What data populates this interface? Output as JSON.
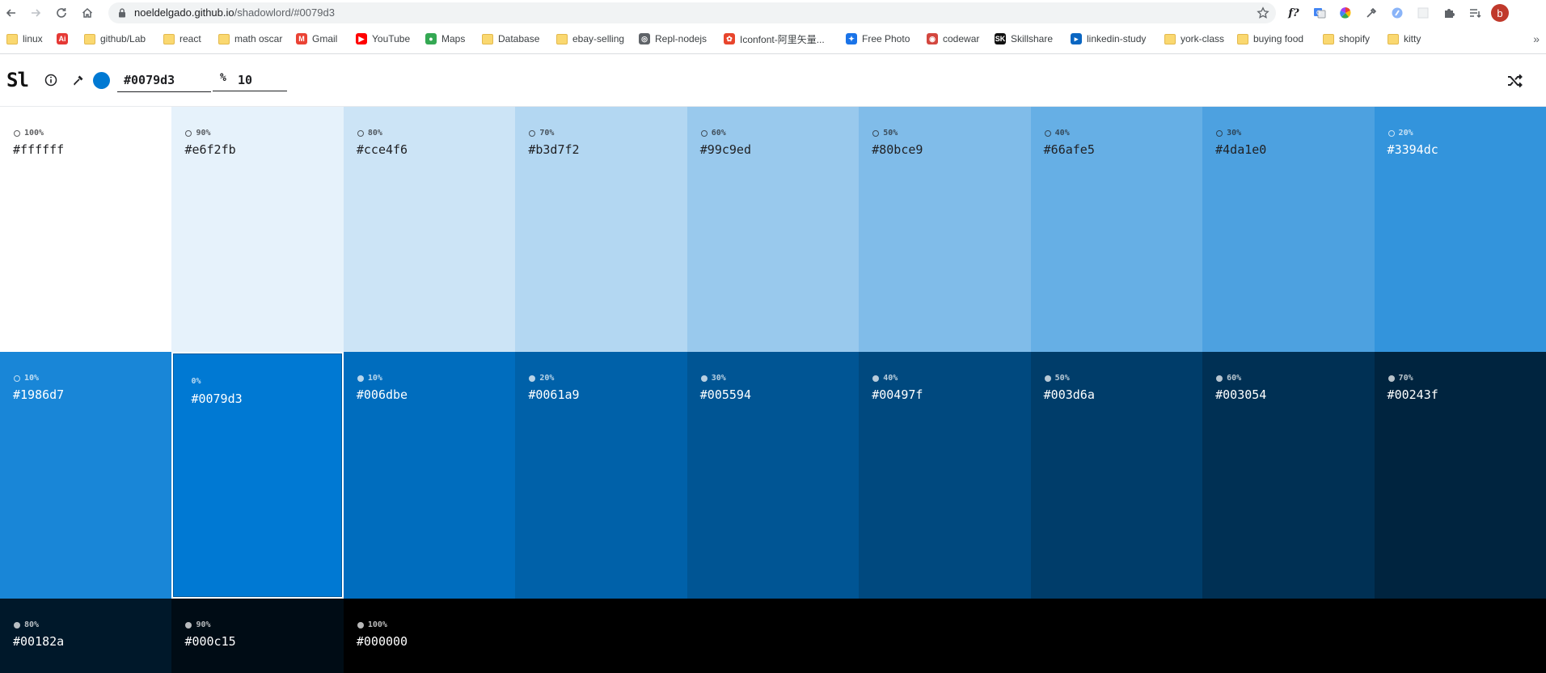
{
  "browser": {
    "url_host": "noeldelgado.github.io",
    "url_path": "/shadowlord/#0079d3",
    "extensions": [
      "f?",
      "google-translate-icon",
      "color-wheel-icon",
      "eyedropper-icon",
      "vpn-icon",
      "blank-ext-icon",
      "puzzle-icon",
      "reading-list-icon"
    ],
    "profile_initial": "b",
    "bookmarks": [
      {
        "label": "linux",
        "icon": "folder"
      },
      {
        "label": "",
        "icon": "adobe"
      },
      {
        "label": "github/Lab",
        "icon": "folder"
      },
      {
        "label": "react",
        "icon": "folder"
      },
      {
        "label": "math oscar",
        "icon": "folder"
      },
      {
        "label": "Gmail",
        "icon": "gmail"
      },
      {
        "label": "YouTube",
        "icon": "youtube"
      },
      {
        "label": "Maps",
        "icon": "maps"
      },
      {
        "label": "Database",
        "icon": "folder"
      },
      {
        "label": "ebay-selling",
        "icon": "folder"
      },
      {
        "label": "Repl-nodejs",
        "icon": "replit"
      },
      {
        "label": "Iconfont-阿里矢量...",
        "icon": "iconfont"
      },
      {
        "label": "Free Photo",
        "icon": "photo"
      },
      {
        "label": "codewar",
        "icon": "codewars"
      },
      {
        "label": "Skillshare",
        "icon": "skillshare"
      },
      {
        "label": "linkedin-study",
        "icon": "linkedin"
      },
      {
        "label": "york-class",
        "icon": "folder"
      },
      {
        "label": "buying food",
        "icon": "folder"
      },
      {
        "label": "shopify",
        "icon": "folder"
      },
      {
        "label": "kitty",
        "icon": "folder"
      }
    ],
    "more_label": "»"
  },
  "app": {
    "logo": "Sl",
    "base_color": "#0079d3",
    "color_value": "#0079d3",
    "step_icon": "%",
    "step_value": "10"
  },
  "tints": [
    {
      "pct": "100%",
      "hex": "#ffffff"
    },
    {
      "pct": "90%",
      "hex": "#e6f2fb"
    },
    {
      "pct": "80%",
      "hex": "#cce4f6"
    },
    {
      "pct": "70%",
      "hex": "#b3d7f2"
    },
    {
      "pct": "60%",
      "hex": "#99c9ed"
    },
    {
      "pct": "50%",
      "hex": "#80bce9"
    },
    {
      "pct": "40%",
      "hex": "#66afe5"
    },
    {
      "pct": "30%",
      "hex": "#4da1e0"
    },
    {
      "pct": "20%",
      "hex": "#3394dc"
    },
    {
      "pct": "10%",
      "hex": "#1986d7"
    }
  ],
  "base": {
    "pct": "0%",
    "hex": "#0079d3"
  },
  "shades": [
    {
      "pct": "10%",
      "hex": "#006dbe"
    },
    {
      "pct": "20%",
      "hex": "#0061a9"
    },
    {
      "pct": "30%",
      "hex": "#005594"
    },
    {
      "pct": "40%",
      "hex": "#00497f"
    },
    {
      "pct": "50%",
      "hex": "#003d6a"
    },
    {
      "pct": "60%",
      "hex": "#003054"
    },
    {
      "pct": "70%",
      "hex": "#00243f"
    },
    {
      "pct": "80%",
      "hex": "#00182a"
    },
    {
      "pct": "90%",
      "hex": "#000c15"
    },
    {
      "pct": "100%",
      "hex": "#000000"
    }
  ]
}
